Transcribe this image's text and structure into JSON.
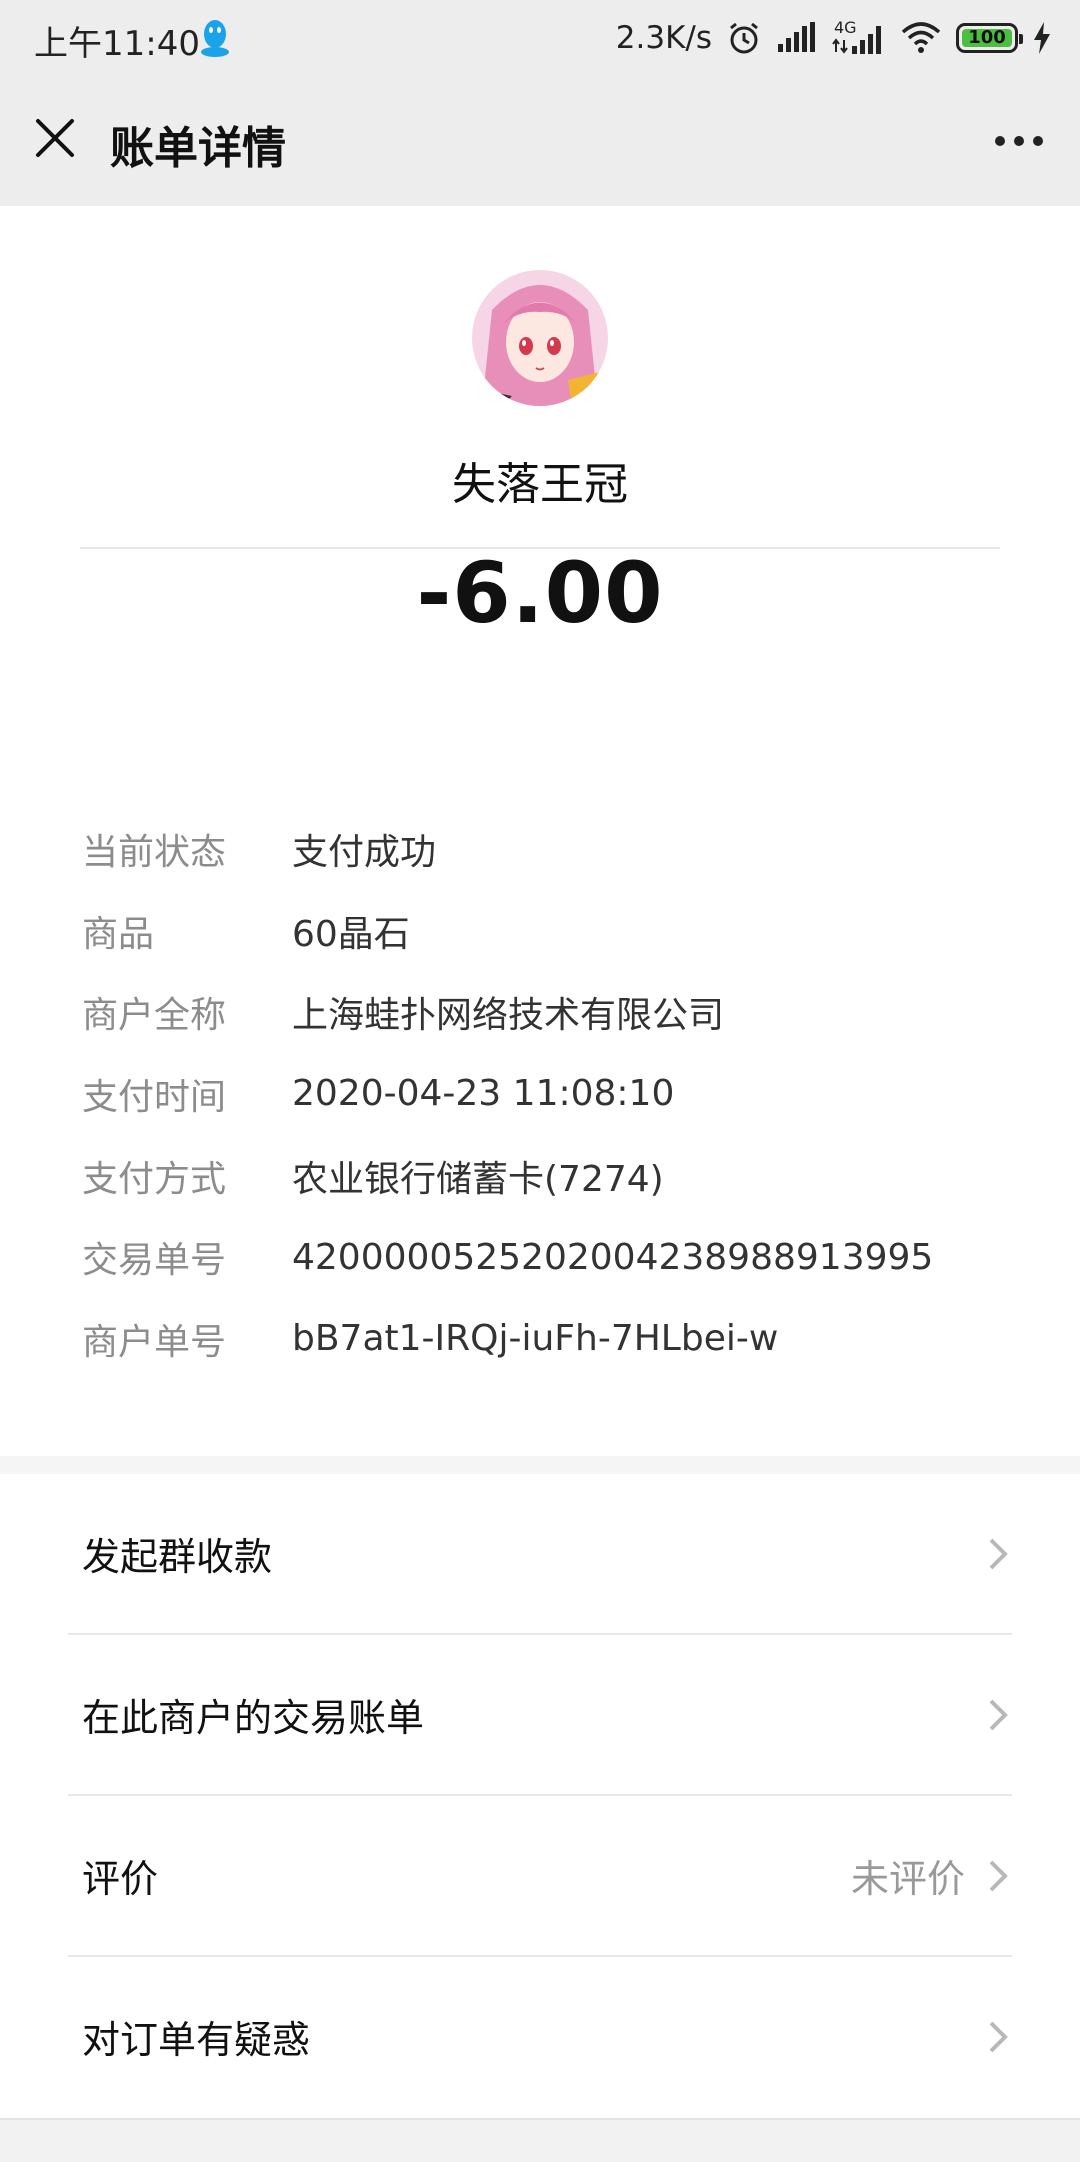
{
  "status_bar": {
    "time": "上午11:40",
    "speed": "2.3K/s",
    "network": "4G",
    "battery": "100"
  },
  "nav": {
    "title": "账单详情"
  },
  "merchant": {
    "name": "失落王冠",
    "amount": "-6.00"
  },
  "details": [
    {
      "label": "当前状态",
      "value": "支付成功"
    },
    {
      "label": "商品",
      "value": "60晶石"
    },
    {
      "label": "商户全称",
      "value": "上海蛙扑网络技术有限公司"
    },
    {
      "label": "支付时间",
      "value": "2020-04-23 11:08:10"
    },
    {
      "label": "支付方式",
      "value": "农业银行储蓄卡(7274)"
    },
    {
      "label": "交易单号",
      "value": "4200000525202004238988913995"
    },
    {
      "label": "商户单号",
      "value": "bB7at1-IRQj-iuFh-7HLbei-w"
    }
  ],
  "menu": [
    {
      "label": "发起群收款",
      "side": ""
    },
    {
      "label": "在此商户的交易账单",
      "side": ""
    },
    {
      "label": "评价",
      "side": "未评价"
    },
    {
      "label": "对订单有疑惑",
      "side": ""
    }
  ],
  "colors": {
    "battery": "#4cbf43",
    "header_bg": "#ededed"
  }
}
